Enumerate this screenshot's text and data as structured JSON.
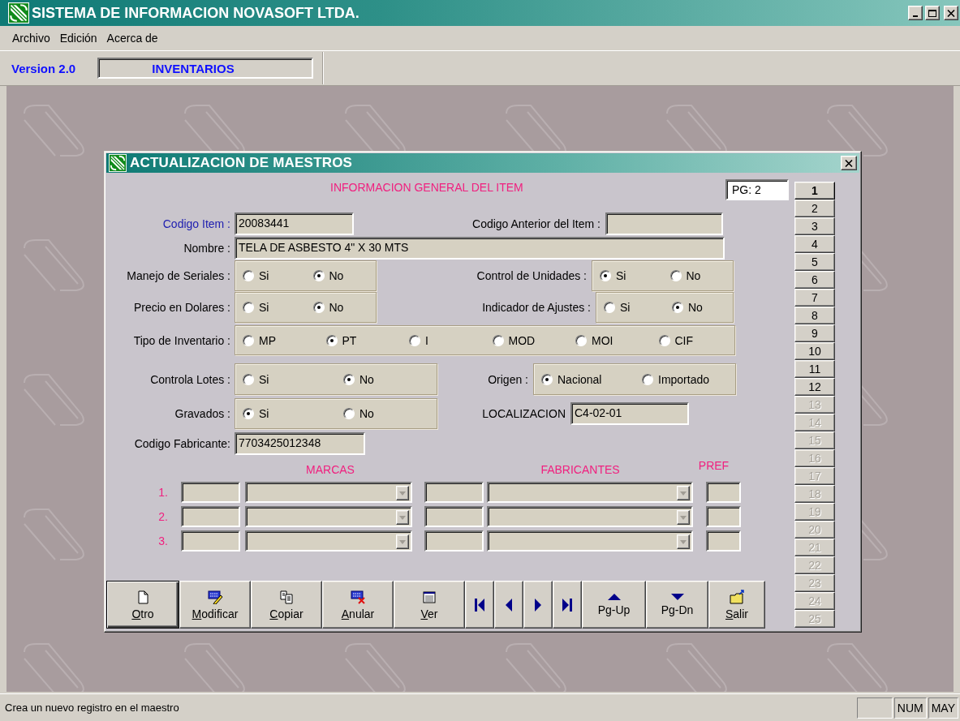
{
  "window": {
    "title": "SISTEMA DE INFORMACION NOVASOFT LTDA."
  },
  "menu": [
    "Archivo",
    "Edición",
    "Acerca de"
  ],
  "toolbar": {
    "version": "Version 2.0",
    "module": "INVENTARIOS"
  },
  "dialog": {
    "title": "ACTUALIZACION DE MAESTROS",
    "heading": "INFORMACION GENERAL DEL ITEM",
    "page": "PG: 2",
    "form_rows": [
      {
        "items": [
          {
            "kind": "field",
            "label": "Codigo Item :",
            "value": "20083441",
            "key_field": true
          },
          {
            "kind": "field",
            "label": "Codigo Anterior del Item :",
            "key_field": false
          }
        ]
      },
      {
        "items": [
          {
            "kind": "field",
            "label": "Nombre :",
            "value": "TELA DE ASBESTO 4\" X 30 MTS",
            "key_field": false
          }
        ]
      },
      {
        "items": [
          {
            "kind": "radio",
            "label": "Manejo de Seriales :",
            "options": [
              {
                "label": "Si",
                "selected": false
              },
              {
                "label": "No",
                "selected": true
              }
            ]
          },
          {
            "kind": "radio",
            "label": "Control de Unidades :",
            "options": [
              {
                "label": "Si",
                "selected": true
              },
              {
                "label": "No",
                "selected": false
              }
            ]
          }
        ]
      },
      {
        "items": [
          {
            "kind": "radio",
            "label": "Precio en Dolares :",
            "options": [
              {
                "label": "Si",
                "selected": false
              },
              {
                "label": "No",
                "selected": true
              }
            ]
          },
          {
            "kind": "radio",
            "label": "Indicador de Ajustes :",
            "options": [
              {
                "label": "Si",
                "selected": false
              },
              {
                "label": "No",
                "selected": true
              }
            ]
          }
        ]
      },
      {
        "items": [
          {
            "kind": "radio",
            "label": "Tipo de Inventario :",
            "options": [
              {
                "label": "MP",
                "selected": false
              },
              {
                "label": "PT",
                "selected": true
              },
              {
                "label": "I",
                "selected": false
              },
              {
                "label": "MOD",
                "selected": false
              },
              {
                "label": "MOI",
                "selected": false
              },
              {
                "label": "CIF",
                "selected": false
              }
            ]
          }
        ]
      },
      {
        "items": [
          {
            "kind": "radio",
            "label": "Controla Lotes :",
            "options": [
              {
                "label": "Si",
                "selected": false
              },
              {
                "label": "No",
                "selected": true
              }
            ]
          },
          {
            "kind": "radio",
            "label": "Origen :",
            "options": [
              {
                "label": "Nacional",
                "selected": true
              },
              {
                "label": "Importado",
                "selected": false
              }
            ]
          }
        ]
      },
      {
        "items": [
          {
            "kind": "radio",
            "label": "Gravados :",
            "options": [
              {
                "label": "Si",
                "selected": true
              },
              {
                "label": "No",
                "selected": false
              }
            ]
          },
          {
            "kind": "field",
            "label": "LOCALIZACION",
            "value": "C4-02-01",
            "key_field": false
          }
        ]
      },
      {
        "items": [
          {
            "kind": "field",
            "label": "Codigo Fabricante:",
            "value": "7703425012348",
            "key_field": false
          }
        ]
      }
    ],
    "brands": {
      "headers": [
        "MARCAS",
        "FABRICANTES",
        "PREF"
      ],
      "rows": [
        {
          "number": "1."
        },
        {
          "number": "2."
        },
        {
          "number": "3."
        }
      ]
    },
    "buttons": [
      {
        "kind": "new",
        "label": "Otro",
        "underlined_initial": true
      },
      {
        "kind": "edit",
        "label": "Modificar",
        "underlined_initial": true
      },
      {
        "kind": "copy",
        "label": "Copiar",
        "underlined_initial": true
      },
      {
        "kind": "cancel",
        "label": "Anular",
        "underlined_initial": true
      },
      {
        "kind": "view",
        "label": "Ver",
        "underlined_initial": true
      },
      {
        "kind": "first"
      },
      {
        "kind": "previous"
      },
      {
        "kind": "next"
      },
      {
        "kind": "last"
      },
      {
        "kind": "page_up",
        "label": "Pg-Up",
        "underlined_initial": false
      },
      {
        "kind": "page_down",
        "label": "Pg-Dn",
        "underlined_initial": false
      },
      {
        "kind": "exit",
        "label": "Salir",
        "underlined_initial": true
      }
    ],
    "page_tabs": [
      {
        "label": "1",
        "selected": true,
        "disabled": false
      },
      {
        "label": "2",
        "selected": false,
        "disabled": false
      },
      {
        "label": "3",
        "selected": false,
        "disabled": false
      },
      {
        "label": "4",
        "selected": false,
        "disabled": false
      },
      {
        "label": "5",
        "selected": false,
        "disabled": false
      },
      {
        "label": "6",
        "selected": false,
        "disabled": false
      },
      {
        "label": "7",
        "selected": false,
        "disabled": false
      },
      {
        "label": "8",
        "selected": false,
        "disabled": false
      },
      {
        "label": "9",
        "selected": false,
        "disabled": false
      },
      {
        "label": "10",
        "selected": false,
        "disabled": false
      },
      {
        "label": "11",
        "selected": false,
        "disabled": false
      },
      {
        "label": "12",
        "selected": false,
        "disabled": false
      },
      {
        "label": "13",
        "selected": false,
        "disabled": true
      },
      {
        "label": "14",
        "selected": false,
        "disabled": true
      },
      {
        "label": "15",
        "selected": false,
        "disabled": true
      },
      {
        "label": "16",
        "selected": false,
        "disabled": true
      },
      {
        "label": "17",
        "selected": false,
        "disabled": true
      },
      {
        "label": "18",
        "selected": false,
        "disabled": true
      },
      {
        "label": "19",
        "selected": false,
        "disabled": true
      },
      {
        "label": "20",
        "selected": false,
        "disabled": true
      },
      {
        "label": "21",
        "selected": false,
        "disabled": true
      },
      {
        "label": "22",
        "selected": false,
        "disabled": true
      },
      {
        "label": "23",
        "selected": false,
        "disabled": true
      },
      {
        "label": "24",
        "selected": false,
        "disabled": true
      },
      {
        "label": "25",
        "selected": false,
        "disabled": true
      }
    ]
  },
  "status_bar": {
    "message": "Crea un nuevo registro en el maestro",
    "indicators": [
      "NUM",
      "MAY"
    ]
  }
}
